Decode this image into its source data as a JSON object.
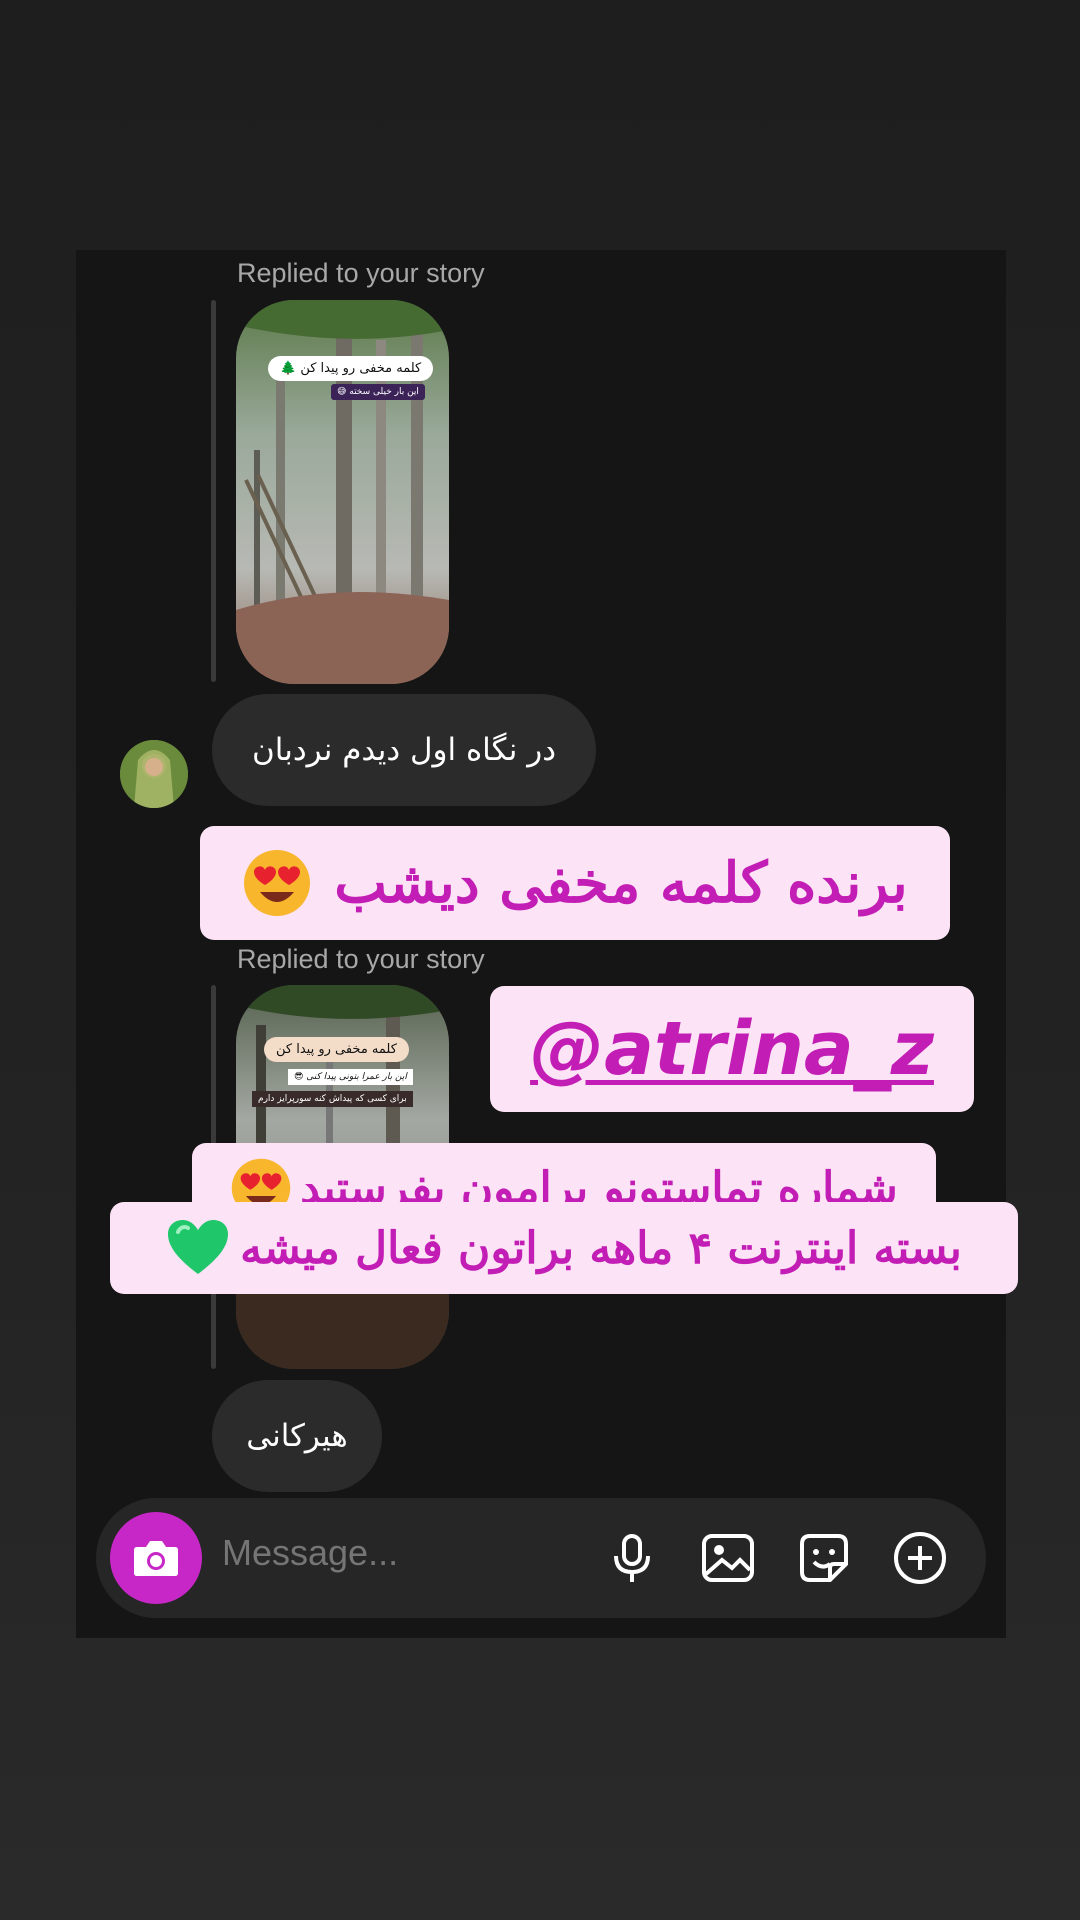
{
  "thread": {
    "reply_label_1": "Replied to your story",
    "reply_label_2": "Replied to your story",
    "story1": {
      "title": "کلمه مخفی رو پیدا کن 🌲",
      "tag": "این بار خیلی سخته 😅"
    },
    "story2": {
      "title": "کلمه مخفی رو پیدا کن",
      "subtitle": "این بار عمرا بتونی پیدا کنی 😎",
      "tag": "برای کسی که پیداش کنه سورپرایز دارم"
    },
    "message1": "در نگاه اول دیدم نردبان",
    "message2": "هیرکانی"
  },
  "overlays": {
    "winner_text": "برنده کلمه مخفی دیشب",
    "mention": "@atrina_z",
    "line1": "شماره تماستونو برامون بفرستید",
    "line2": "بسته اینترنت ۴ ماهه براتون فعال میشه"
  },
  "composer": {
    "placeholder": "Message...",
    "icons": [
      "camera-icon",
      "microphone-icon",
      "gallery-icon",
      "sticker-icon",
      "add-icon"
    ]
  },
  "colors": {
    "accent": "#c727c7",
    "overlay_bg": "#fde3f6",
    "overlay_text": "#c21db5"
  }
}
